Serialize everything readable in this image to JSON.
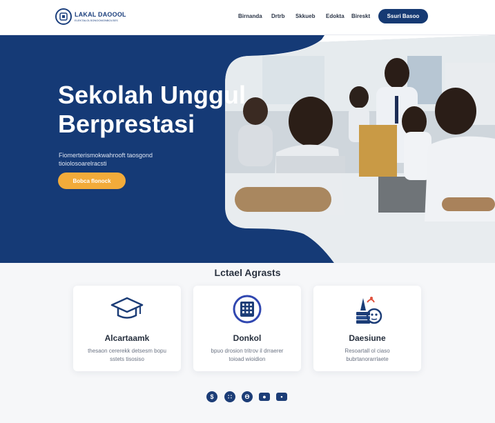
{
  "header": {
    "logo_name": "LAKAL DAOOOL",
    "logo_tagline": "ELEKTALOLSONOOMONBOLSES",
    "nav": [
      "Birnanda",
      "Drtrb",
      "Skkueb",
      "Edokta",
      "Bireskt"
    ],
    "cta": "Ssuri   Basoo"
  },
  "hero": {
    "title_line1": "Sekolah Unggul",
    "title_line2": "Berprestasi",
    "subtitle": "Fiomerterismokwahrooft taosgond tioiolosoarelracsti",
    "button": "Bobca flonock"
  },
  "section": {
    "title": "Lctael Agrasts",
    "cards": [
      {
        "icon": "graduation-cap-icon",
        "title": "Alcartaamk",
        "desc": "thesaon cererekk detsesm bopu sstets tisosiso"
      },
      {
        "icon": "calculator-icon",
        "title": "Donkol",
        "desc": "bpuo drosion tritrov il drraerer toioad wioidion"
      },
      {
        "icon": "science-books-icon",
        "title": "Daesiune",
        "desc": "Resoartall ol ciaso bubrtanorarrlaete"
      }
    ]
  },
  "socials": [
    {
      "icon": "social-icon-1",
      "glyph": "$"
    },
    {
      "icon": "social-icon-2",
      "glyph": "∷"
    },
    {
      "icon": "social-icon-3",
      "glyph": "Ɵ"
    },
    {
      "icon": "social-icon-4",
      "glyph": "●"
    },
    {
      "icon": "social-icon-5",
      "glyph": "▪"
    }
  ],
  "colors": {
    "navy": "#153a76",
    "accent": "#f2ab3a",
    "white": "#ffffff"
  }
}
